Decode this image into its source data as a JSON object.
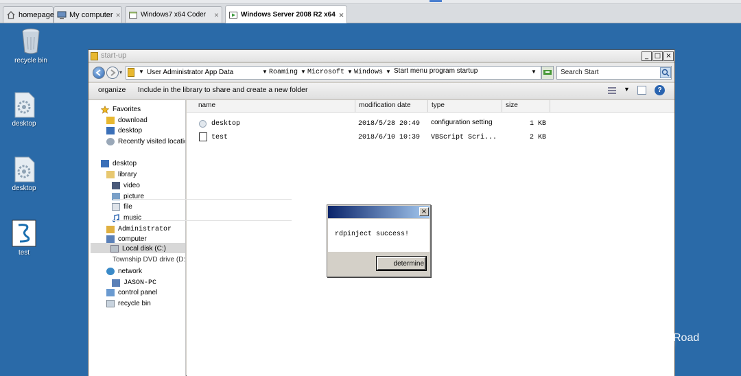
{
  "host_tabs": [
    {
      "label": "homepage",
      "icon": "home-icon",
      "close": ""
    },
    {
      "label": "My computer",
      "icon": "computer-icon",
      "close": "×"
    },
    {
      "label": "Windows7 x64 Coder",
      "icon": "vm-icon",
      "close": "×"
    },
    {
      "label": "Windows Server 2008 R2 x64",
      "icon": "vm-play-icon",
      "close": "×",
      "active": true
    }
  ],
  "desktop_icons": [
    {
      "label": "recycle bin",
      "icon": "recycle-bin-icon"
    },
    {
      "label": "desktop",
      "icon": "settings-file-icon"
    },
    {
      "label": "desktop",
      "icon": "settings-file-icon"
    },
    {
      "label": "test",
      "icon": "vbscript-file-icon"
    }
  ],
  "window": {
    "title": "start-up",
    "buttons": {
      "minimize": "_",
      "maximize": "□",
      "close": "×"
    }
  },
  "address": {
    "crumbs": [
      "User Administrator App Data",
      "Roaming",
      "Microsoft",
      "Windows",
      "Start menu program startup"
    ],
    "search_placeholder": "Search Start"
  },
  "commands": {
    "organize": "organize",
    "include": "Include in the library to share and create a new folder"
  },
  "nav": {
    "favorites": "Favorites",
    "download": "download",
    "desktop1": "desktop",
    "recent": "Recently visited location",
    "desktop2": "desktop",
    "library": "library",
    "video": "video",
    "picture": "picture",
    "file": "file",
    "music": "music",
    "administrator": "Administrator",
    "computer": "computer",
    "local_disk": "Local disk (C:)",
    "dvd": "Township DVD drive (D:)",
    "network": "network",
    "jason": "JASON-PC",
    "control_panel": "control panel",
    "recycle": "recycle bin"
  },
  "columns": {
    "name": "name",
    "date": "modification date",
    "type": "type",
    "size": "size"
  },
  "files": [
    {
      "name": "desktop",
      "date": "2018/5/28 20:49",
      "type": "configuration setting",
      "size": "1 KB",
      "icon": "settings-file-icon"
    },
    {
      "name": "test",
      "date": "2018/6/10 10:39",
      "type": "VBScript Scri...",
      "size": "2 KB",
      "icon": "vbscript-file-icon"
    }
  ],
  "dialog": {
    "message": "rdpinject success!",
    "close": "×",
    "ok_label": "determine"
  },
  "watermark": {
    "text": "Road"
  },
  "colors": {
    "desktop": "#2a6aa8",
    "dialog_title_start": "#0a246a",
    "dialog_title_end": "#a6caf0"
  }
}
